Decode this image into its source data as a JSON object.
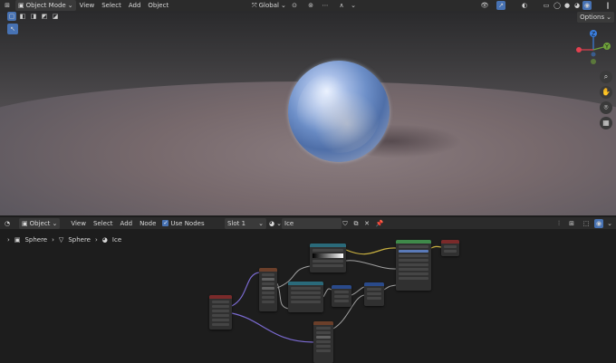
{
  "top_header": {
    "mode": "Object Mode",
    "menus": [
      "View",
      "Select",
      "Add",
      "Object"
    ],
    "orientation": "Global",
    "options_label": "Options"
  },
  "gizmo": {
    "axes": {
      "z": "Z",
      "x": "X",
      "y": "Y"
    },
    "colors": {
      "x": "#e2404f",
      "y": "#6fa23b",
      "z": "#3b7fe0"
    }
  },
  "node_header": {
    "editor_type": "Object",
    "menus": [
      "View",
      "Select",
      "Add",
      "Node"
    ],
    "use_nodes_label": "Use Nodes",
    "use_nodes_checked": true,
    "slot": "Slot 1",
    "material": "Ice"
  },
  "breadcrumb": [
    "Sphere",
    "Sphere",
    "Ice"
  ],
  "colors": {
    "accent": "#4772b3",
    "node_header_texture": "#6b3f2a",
    "node_header_converter": "#2a6a7a",
    "node_header_shader": "#3f8a4a",
    "node_header_output": "#7a2a2a",
    "link_yellow": "#c8b040",
    "link_purple": "#7a6ad0",
    "link_gray": "#a0a0a0"
  }
}
